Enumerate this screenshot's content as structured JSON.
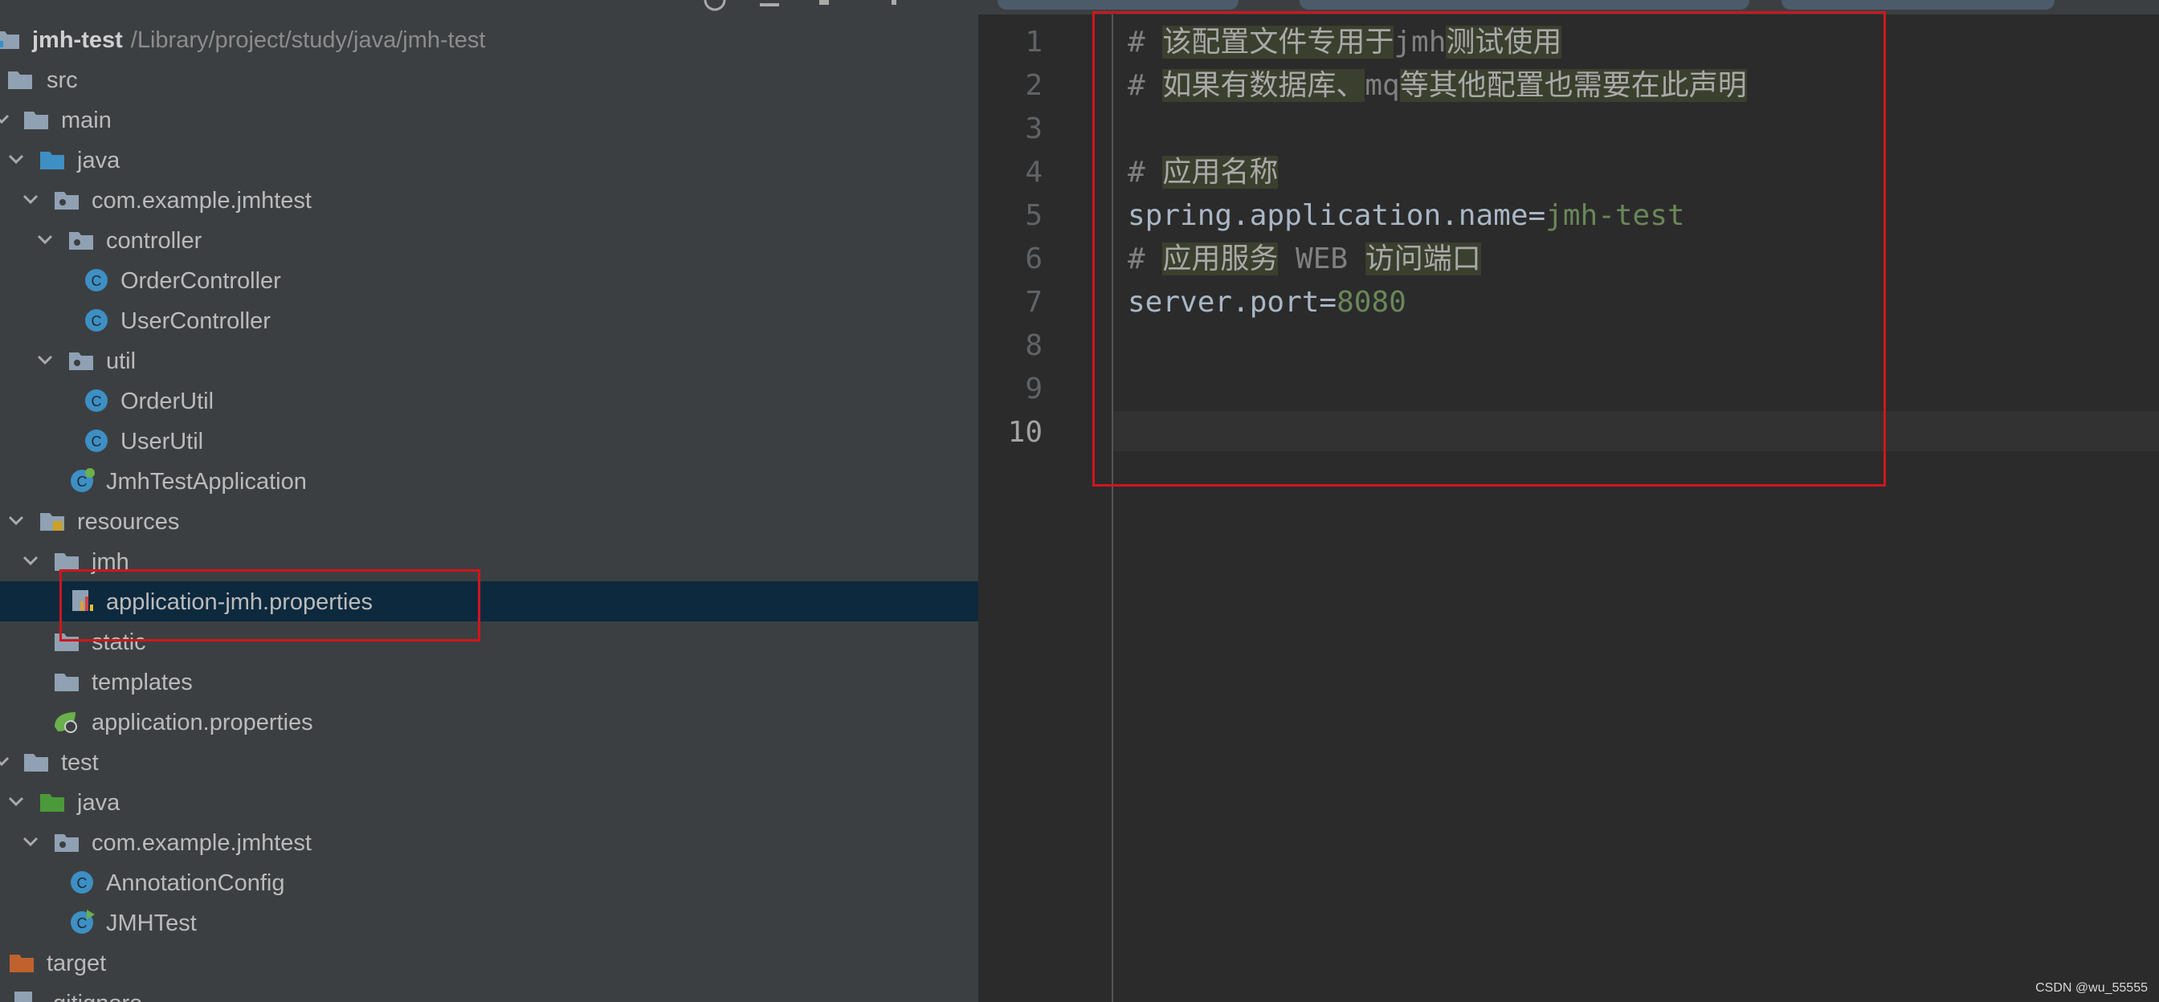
{
  "project": {
    "name": "jmh-test",
    "path": "/Library/project/study/java/jmh-test"
  },
  "tree": [
    {
      "label": "src"
    },
    {
      "label": "main"
    },
    {
      "label": "java"
    },
    {
      "label": "com.example.jmhtest"
    },
    {
      "label": "controller"
    },
    {
      "label": "OrderController"
    },
    {
      "label": "UserController"
    },
    {
      "label": "util"
    },
    {
      "label": "OrderUtil"
    },
    {
      "label": "UserUtil"
    },
    {
      "label": "JmhTestApplication"
    },
    {
      "label": "resources"
    },
    {
      "label": "jmh"
    },
    {
      "label": "application-jmh.properties"
    },
    {
      "label": "static"
    },
    {
      "label": "templates"
    },
    {
      "label": "application.properties"
    },
    {
      "label": "test"
    },
    {
      "label": "java"
    },
    {
      "label": "com.example.jmhtest"
    },
    {
      "label": "AnnotationConfig"
    },
    {
      "label": "JMHTest"
    },
    {
      "label": "target"
    },
    {
      "label": ".gitignore"
    }
  ],
  "editor": {
    "line_numbers": [
      "1",
      "2",
      "3",
      "4",
      "5",
      "6",
      "7",
      "8",
      "9",
      "10"
    ],
    "lines": {
      "l1_hash": "# ",
      "l1_a": "该配置文件专用于",
      "l1_b": "jmh",
      "l1_c": "测试使用",
      "l2_hash": "# ",
      "l2_a": "如果有数据库、",
      "l2_b": "mq",
      "l2_c": "等其他配置也需要在此声明",
      "l4_hash": "# ",
      "l4_a": "应用名称",
      "l5_key": "spring.application.name=",
      "l5_val": "jmh-test",
      "l6_hash": "# ",
      "l6_a": "应用服务",
      "l6_b": " WEB ",
      "l6_c": "访问端口",
      "l7_key": "server.port=",
      "l7_val": "8080"
    }
  },
  "watermark": "CSDN @wu_55555"
}
